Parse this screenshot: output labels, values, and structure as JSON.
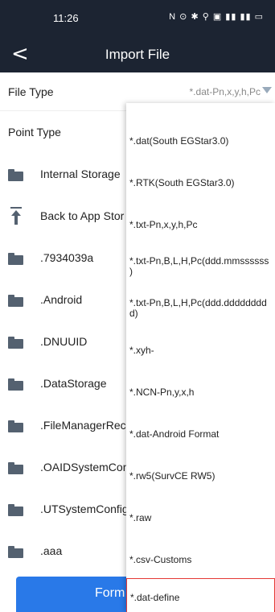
{
  "status_bar": {
    "time": "11:26",
    "icons_text": "N ⊙ ✱ ⚲ ▣ ▮▮ ▮▮ ▭"
  },
  "app_bar": {
    "back_glyph": "<",
    "title": "Import File"
  },
  "file_type": {
    "label": "File Type",
    "value": "*.dat-Pn,x,y,h,Pc"
  },
  "point_type": {
    "label": "Point Type"
  },
  "folders": [
    {
      "name": "Internal Storage",
      "icon": "folder-open-icon"
    },
    {
      "name": "Back to App Stor",
      "icon": "upload-arrow-icon"
    },
    {
      "name": ".7934039a",
      "icon": "folder-icon"
    },
    {
      "name": ".Android",
      "icon": "folder-icon"
    },
    {
      "name": ".DNUUID",
      "icon": "folder-icon"
    },
    {
      "name": ".DataStorage",
      "icon": "folder-icon"
    },
    {
      "name": ".FileManagerRec",
      "icon": "folder-icon"
    },
    {
      "name": ".OAIDSystemCon",
      "icon": "folder-icon"
    },
    {
      "name": ".UTSystemConfig",
      "icon": "folder-icon"
    },
    {
      "name": ".aaa",
      "icon": "folder-icon"
    }
  ],
  "bottom_button": {
    "label": "Form"
  },
  "dropdown": {
    "options": [
      {
        "line1": "*.dat(South EGStar3.0)",
        "line2": ""
      },
      {
        "line1": "*.RTK(South EGStar3.0)",
        "line2": ""
      },
      {
        "line1": "*.txt-Pn,x,y,h,Pc",
        "line2": ""
      },
      {
        "line1": "*.txt-Pn,B,L,H,Pc(ddd.mmssssss",
        "line2": ")"
      },
      {
        "line1": "*.txt-Pn,B,L,H,Pc(ddd.dddddddd",
        "line2": "d)"
      },
      {
        "line1": "*.xyh-",
        "line2": ""
      },
      {
        "line1": "*.NCN-Pn,y,x,h",
        "line2": ""
      },
      {
        "line1": "*.dat-Android Format",
        "line2": ""
      },
      {
        "line1": "*.rw5(SurvCE RW5)",
        "line2": ""
      },
      {
        "line1": "*.raw",
        "line2": ""
      },
      {
        "line1": "*.csv-Customs",
        "line2": ""
      },
      {
        "line1": "*.dat-define",
        "line2": ""
      }
    ],
    "selected_index": 11,
    "selected_border_color": "#e53935"
  },
  "colors": {
    "header_bg": "#1c2432",
    "button_bg": "#2979e8",
    "icon_color": "#546170"
  }
}
